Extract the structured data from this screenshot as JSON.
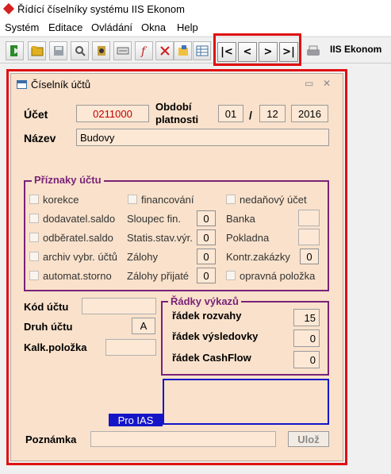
{
  "app": {
    "title": "Řídící číselníky systému IIS Ekonom"
  },
  "menu": [
    "Systém",
    "Editace",
    "Ovládání",
    "Okna",
    "Help"
  ],
  "toolbar": {
    "nav": {
      "first": "|<",
      "prev": "<",
      "next": ">",
      "last": ">|"
    },
    "brand": "IIS Ekonom"
  },
  "window": {
    "title": "Číselník účtů",
    "minimize": "▭",
    "close": "✕"
  },
  "form": {
    "ucet_label": "Účet",
    "ucet_value": "0211000",
    "obdobi_label_1": "Období",
    "obdobi_label_2": "platnosti",
    "obdobi_day": "01",
    "obdobi_sep": "/",
    "obdobi_month": "12",
    "obdobi_year": "2016",
    "nazev_label": "Název",
    "nazev_value": "Budovy"
  },
  "priznaky": {
    "title": "Příznaky účtu",
    "korekce": "korekce",
    "financovani": "financování",
    "nedanovy": "nedaňový účet",
    "dodavatel": "dodavatel.saldo",
    "sloupec": "Sloupec fin.",
    "sloupec_value": "0",
    "banka": "Banka",
    "odberatel": "odběratel.saldo",
    "statis": "Statis.stav.výr.",
    "statis_value": "0",
    "pokladna": "Pokladna",
    "archiv": "archiv vybr. účtů",
    "zalohy": "Zálohy",
    "zalohy_value": "0",
    "kontr": "Kontr.zakázky",
    "kontr_value": "0",
    "automat": "automat.storno",
    "zalohy_prijate": "Zálohy přijaté",
    "zalohy_prijate_value": "0",
    "opravna": "opravná položka"
  },
  "lower": {
    "kod_label": "Kód účtu",
    "kod_value": "",
    "druh_label": "Druh účtu",
    "druh_value": "A",
    "kalk_label": "Kalk.položka",
    "kalk_value": ""
  },
  "radky": {
    "title": "Řádky výkazů",
    "rozvaha_label": "řádek rozvahy",
    "rozvaha_value": "15",
    "vysledovka_label": "řádek výsledovky",
    "vysledovka_value": "0",
    "cashflow_label": "řádek CashFlow",
    "cashflow_value": "0"
  },
  "ias": {
    "label": "Pro IAS"
  },
  "poznamka": {
    "label": "Poznámka",
    "value": "",
    "save": "Ulož"
  },
  "colors": {
    "panel": "#f9e1cb",
    "field": "#fde8d5",
    "group_border": "#7a2277",
    "ias_blue": "#1515c8",
    "highlight": "#e01010"
  }
}
